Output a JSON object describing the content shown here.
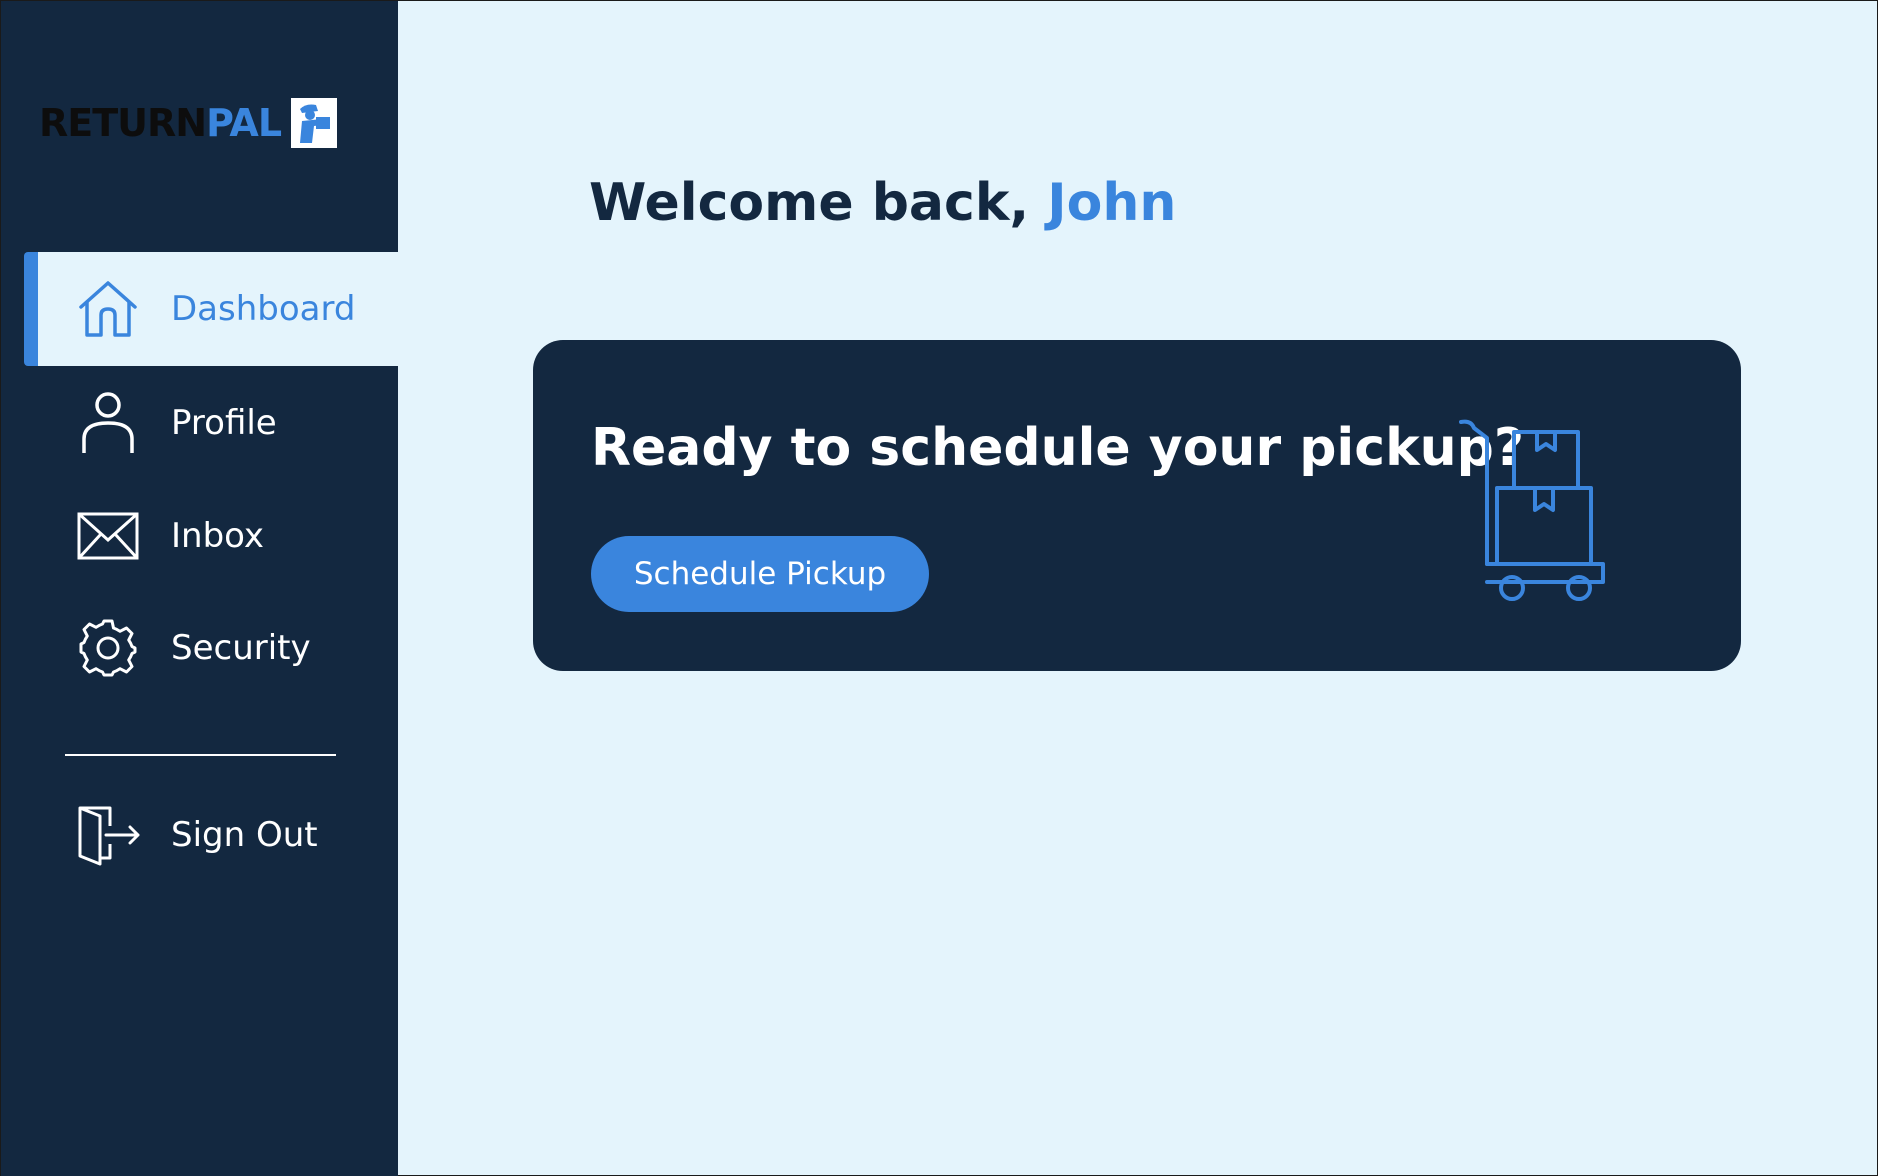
{
  "brand": {
    "logo_return": "RETURN",
    "logo_pal": "PAL",
    "logo_icon": "delivery-person-icon"
  },
  "sidebar": {
    "items": [
      {
        "label": "Dashboard",
        "icon": "home-icon",
        "active": true
      },
      {
        "label": "Profile",
        "icon": "user-icon",
        "active": false
      },
      {
        "label": "Inbox",
        "icon": "envelope-icon",
        "active": false
      },
      {
        "label": "Security",
        "icon": "gear-icon",
        "active": false
      }
    ],
    "sign_out": {
      "label": "Sign Out",
      "icon": "sign-out-door-icon"
    }
  },
  "main": {
    "welcome_prefix": "Welcome back,",
    "user_name": "John",
    "card": {
      "heading": "Ready to schedule your pickup?",
      "button_label": "Schedule Pickup",
      "illustration": "hand-truck-boxes-icon"
    }
  },
  "colors": {
    "sidebar_bg": "#132840",
    "main_bg": "#e4f4fc",
    "accent": "#3a85dd",
    "text_light": "#ffffff",
    "text_dark": "#132840"
  }
}
